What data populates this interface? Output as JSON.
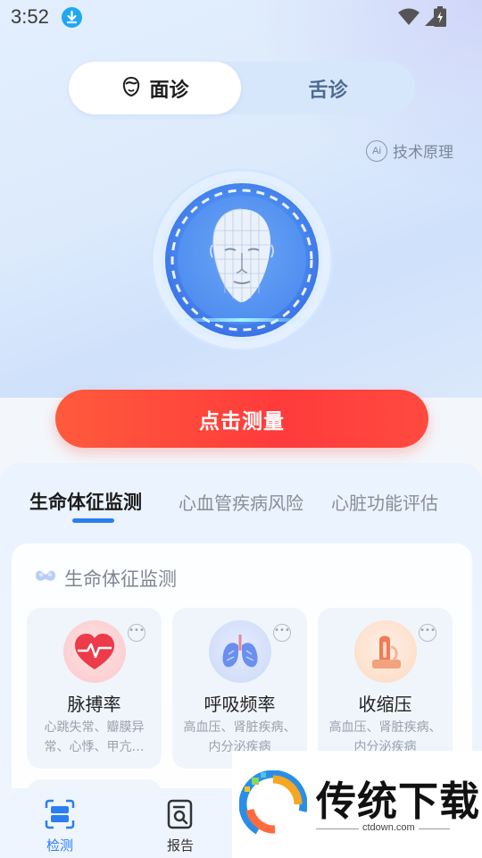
{
  "status_bar": {
    "time": "3:52"
  },
  "mode_toggle": {
    "active_label": "面诊",
    "other_label": "舌诊"
  },
  "tech_link": {
    "badge": "Ai",
    "label": "技术原理"
  },
  "measure_button": {
    "label": "点击测量"
  },
  "category_tabs": [
    {
      "label": "生命体征监测"
    },
    {
      "label": "心血管疾病风险"
    },
    {
      "label": "心脏功能评估"
    }
  ],
  "section": {
    "title": "生命体征监测",
    "items": [
      {
        "name": "脉搏率",
        "desc": "心跳失常、瓣膜异常、心悸、甲亢…"
      },
      {
        "name": "呼吸频率",
        "desc": "高血压、肾脏疾病、内分泌疾病"
      },
      {
        "name": "收缩压",
        "desc": "高血压、肾脏疾病、内分泌疾病"
      }
    ],
    "more_glyph": "•••"
  },
  "bottom_nav": [
    {
      "label": "检测",
      "active": true
    },
    {
      "label": "报告",
      "active": false
    }
  ],
  "watermark": {
    "title": "传统下载",
    "url": "ctdown.com"
  },
  "colors": {
    "accent": "#2b7ef0",
    "measure_button": "#ff3b3b",
    "nav_active": "#2b7ef0",
    "nav_inactive": "#333333"
  }
}
